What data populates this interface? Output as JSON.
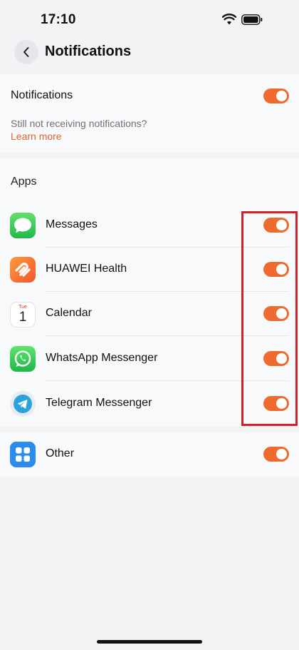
{
  "status_bar": {
    "time": "17:10"
  },
  "header": {
    "title": "Notifications"
  },
  "notifications": {
    "label": "Notifications",
    "enabled": true,
    "hint": "Still not receiving notifications?",
    "learn_more": "Learn more"
  },
  "apps_section": {
    "title": "Apps",
    "items": [
      {
        "name": "Messages",
        "icon": "messages-icon",
        "enabled": true
      },
      {
        "name": "HUAWEI Health",
        "icon": "huawei-health-icon",
        "enabled": true
      },
      {
        "name": "Calendar",
        "icon": "calendar-icon",
        "enabled": true,
        "icon_day": "Tue",
        "icon_date": "1"
      },
      {
        "name": "WhatsApp Messenger",
        "icon": "whatsapp-icon",
        "enabled": true
      },
      {
        "name": "Telegram Messenger",
        "icon": "telegram-icon",
        "enabled": true
      }
    ]
  },
  "other": {
    "name": "Other",
    "icon": "other-apps-icon",
    "enabled": true
  },
  "colors": {
    "accent": "#ef6a2e",
    "link": "#e0652c",
    "highlight": "#d21f2a",
    "background": "#f2f3f5"
  }
}
